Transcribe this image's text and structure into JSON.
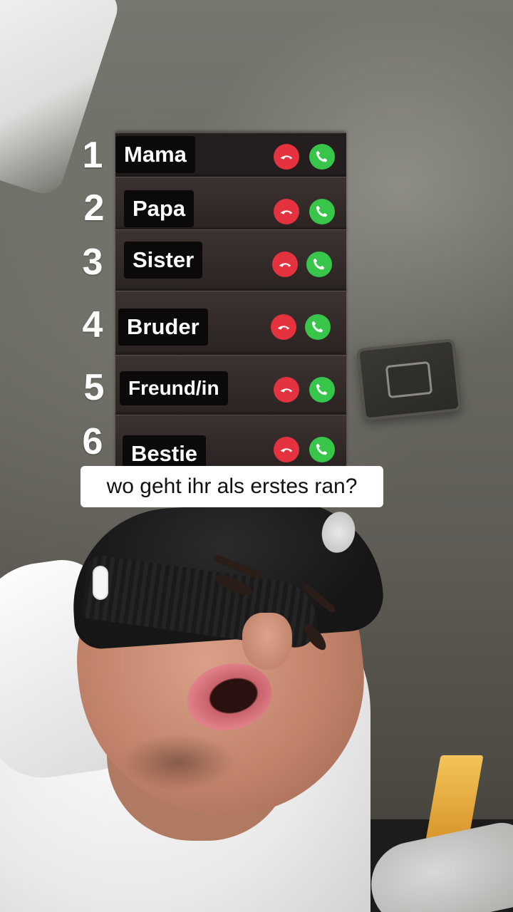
{
  "calls": [
    {
      "rank": "1",
      "name": "Mama"
    },
    {
      "rank": "2",
      "name": "Papa"
    },
    {
      "rank": "3",
      "name": "Sister"
    },
    {
      "rank": "4",
      "name": "Bruder"
    },
    {
      "rank": "5",
      "name": "Freund/in"
    },
    {
      "rank": "6",
      "name": "Bestie"
    }
  ],
  "caption": "wo geht ihr als erstes ran?",
  "icons": {
    "decline": "phone-decline-icon",
    "accept": "phone-accept-icon"
  },
  "colors": {
    "decline": "#e5323f",
    "accept": "#37c64a",
    "caption_bg": "#ffffff"
  }
}
